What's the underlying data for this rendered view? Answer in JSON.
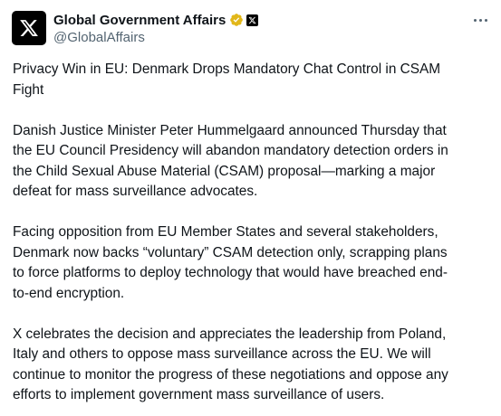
{
  "author": {
    "name": "Global Government Affairs",
    "handle": "@GlobalAffairs",
    "verified_badge_color": "#e2b719",
    "avatar_icon": "x-logo-icon"
  },
  "post": {
    "paragraphs": [
      "Privacy Win in EU: Denmark Drops Mandatory Chat Control in CSAM\nFight",
      "Danish Justice Minister Peter Hummelgaard announced Thursday that\nthe EU Council Presidency will abandon mandatory detection orders in\nthe Child Sexual Abuse Material (CSAM) proposal—marking a major\ndefeat for mass surveillance advocates.",
      "Facing opposition from EU Member States and several stakeholders,\nDenmark now backs “voluntary” CSAM detection only, scrapping plans\nto force platforms to deploy technology that would have breached end-\nto-end encryption.",
      "X celebrates the decision and appreciates the leadership from Poland,\nItaly and others to oppose mass surveillance across the EU. We will\ncontinue to monitor the progress of these negotiations and oppose any\nefforts to implement government mass surveillance of users."
    ]
  },
  "colors": {
    "text": "#0f1419",
    "secondary_text": "#536471",
    "background": "#ffffff"
  }
}
